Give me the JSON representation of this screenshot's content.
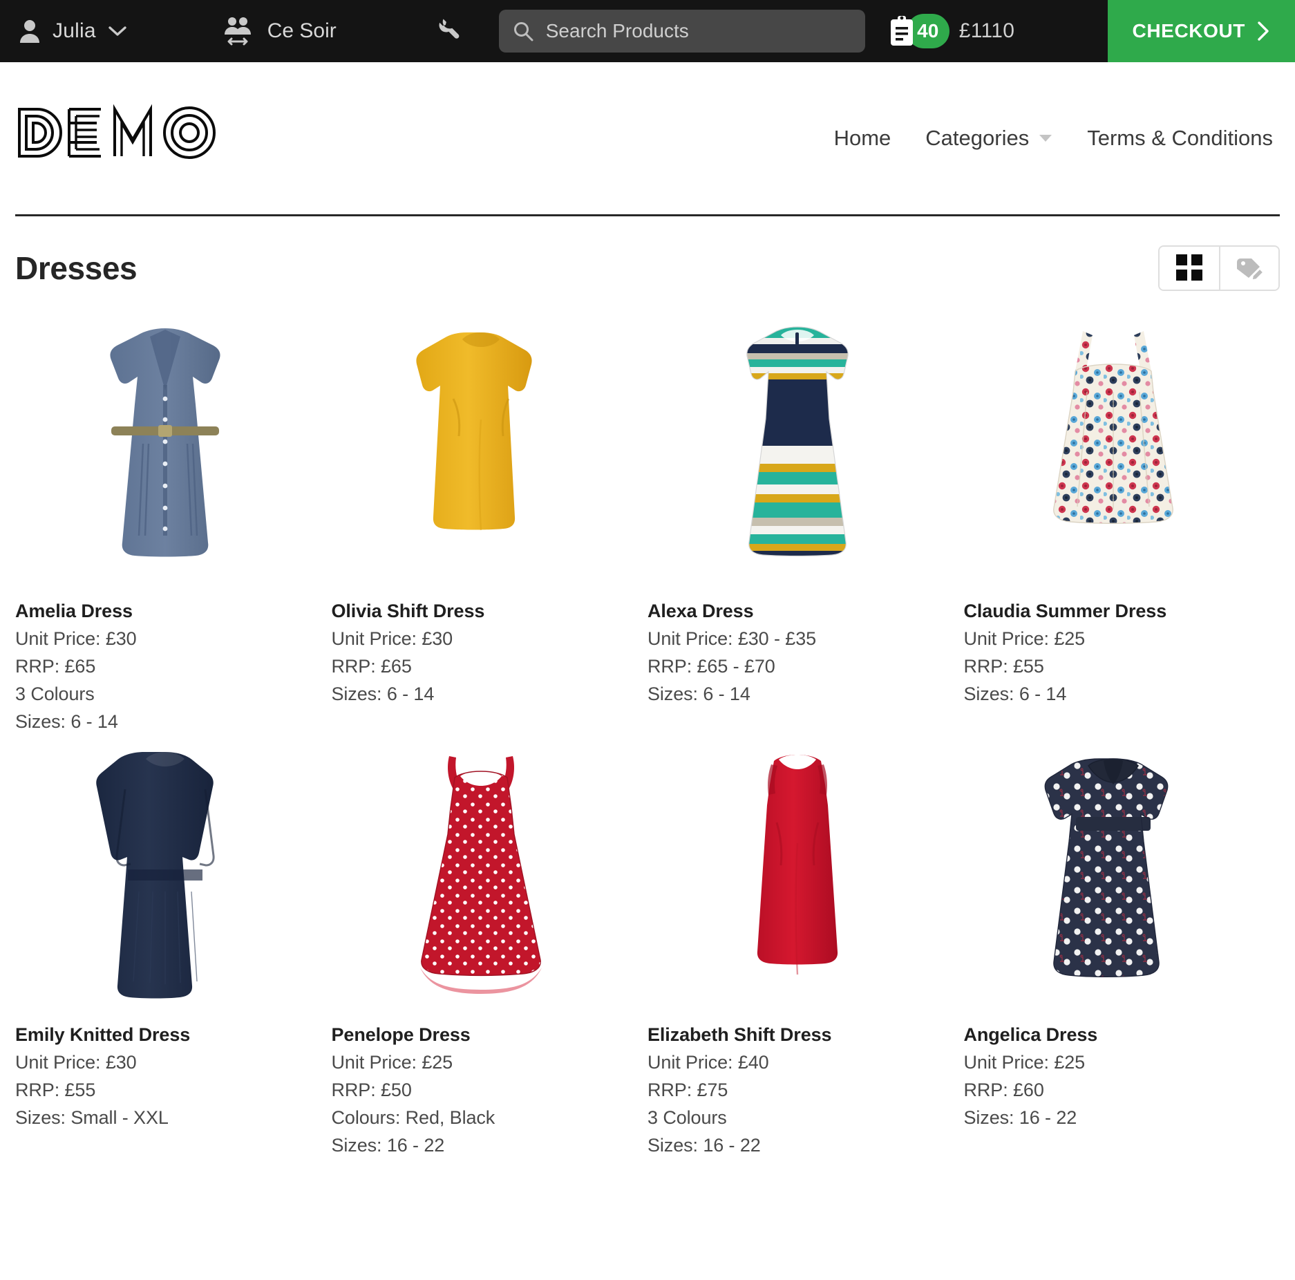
{
  "topbar": {
    "user_name": "Julia",
    "user_icon": "person-icon",
    "user_caret_icon": "chevron-down-icon",
    "team_name": "Ce Soir",
    "team_icon": "people-switch-icon",
    "settings_icon": "wrench-icon",
    "search": {
      "icon": "search-icon",
      "placeholder": "Search Products",
      "value": ""
    },
    "cart": {
      "icon": "clipboard-order-icon",
      "count": "40",
      "total": "£1110",
      "badge_color": "#2faa4b"
    },
    "checkout_label": "CHECKOUT",
    "checkout_icon": "chevron-right-icon",
    "checkout_color": "#2faa4b",
    "background": "#141414"
  },
  "header": {
    "logo_text": "DEMO",
    "nav": [
      {
        "label": "Home",
        "has_caret": false
      },
      {
        "label": "Categories",
        "has_caret": true
      },
      {
        "label": "Terms & Conditions",
        "has_caret": false
      }
    ]
  },
  "main": {
    "page_title": "Dresses",
    "view_toggle": [
      {
        "name": "grid-view",
        "icon": "grid-icon",
        "active": true
      },
      {
        "name": "tag-edit-view",
        "icon": "tag-pencil-icon",
        "active": false
      }
    ],
    "products": [
      {
        "name": "Amelia Dress",
        "image": "denim-shirt-dress",
        "lines": [
          "Unit Price: £30",
          "RRP: £65",
          "3 Colours",
          "Sizes: 6 - 14"
        ]
      },
      {
        "name": "Olivia Shift Dress",
        "image": "mustard-shift-dress",
        "lines": [
          "Unit Price: £30",
          "RRP: £65",
          "Sizes: 6 - 14"
        ]
      },
      {
        "name": "Alexa Dress",
        "image": "striped-aline-dress",
        "lines": [
          "Unit Price: £30 - £35",
          "RRP: £65 - £70",
          "Sizes: 6 - 14"
        ]
      },
      {
        "name": "Claudia Summer Dress",
        "image": "floral-sundress",
        "lines": [
          "Unit Price: £25",
          "RRP: £55",
          "Sizes: 6 - 14"
        ]
      },
      {
        "name": "Emily Knitted Dress",
        "image": "navy-knitted-dress",
        "lines": [
          "Unit Price: £30",
          "RRP: £55",
          "Sizes: Small - XXL"
        ]
      },
      {
        "name": "Penelope Dress",
        "image": "red-polkadot-dress",
        "lines": [
          "Unit Price: £25",
          "RRP: £50",
          "Colours: Red, Black",
          "Sizes: 16 - 22"
        ]
      },
      {
        "name": "Elizabeth Shift Dress",
        "image": "red-shift-dress",
        "lines": [
          "Unit Price: £40",
          "RRP: £75",
          "3 Colours",
          "Sizes: 16 - 22"
        ]
      },
      {
        "name": "Angelica Dress",
        "image": "navy-polkadot-dress",
        "lines": [
          "Unit Price: £25",
          "RRP: £60",
          "Sizes: 16 - 22"
        ]
      }
    ]
  }
}
